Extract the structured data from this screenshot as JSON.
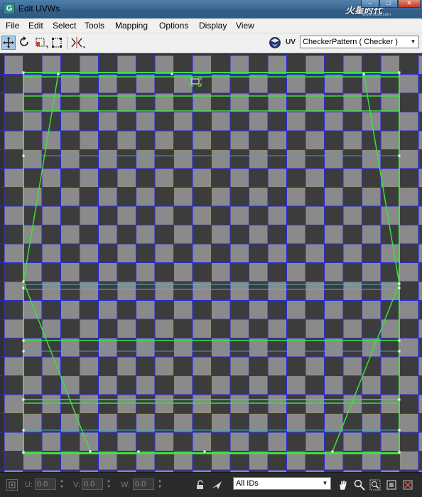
{
  "window": {
    "title": "Edit UVWs",
    "app_icon": "3ds-max-icon",
    "watermark": "火星时代",
    "watermark_url": "www.hxsd.com"
  },
  "menu": {
    "items": [
      "File",
      "Edit",
      "Select",
      "Tools",
      "Mapping",
      "Options",
      "Display",
      "View"
    ]
  },
  "toolbar": {
    "tools": [
      "move-tool-icon",
      "rotate-tool-icon",
      "scale-tool-icon",
      "freeform-tool-icon",
      "mirror-tool-icon"
    ],
    "uv_label": "UV",
    "map_select": "CheckerPattern  ( Checker )"
  },
  "viewport": {
    "checker_light": "#8a8a8a",
    "checker_dark": "#3c3c3c",
    "grid_color": "#2b2bd9",
    "uv_edge_color": "#3ee03e",
    "vertex_color": "#ffffff"
  },
  "statusbar": {
    "u_label": "U:",
    "u_value": "0.0",
    "v_label": "V:",
    "v_value": "0.0",
    "w_label": "W:",
    "w_value": "0.0",
    "ids_select": "All IDs",
    "icons": [
      "lock-icon",
      "paint-icon",
      "pan-icon",
      "zoom-icon",
      "zoom-region-icon",
      "zoom-extents-icon",
      "snap-icon"
    ]
  }
}
